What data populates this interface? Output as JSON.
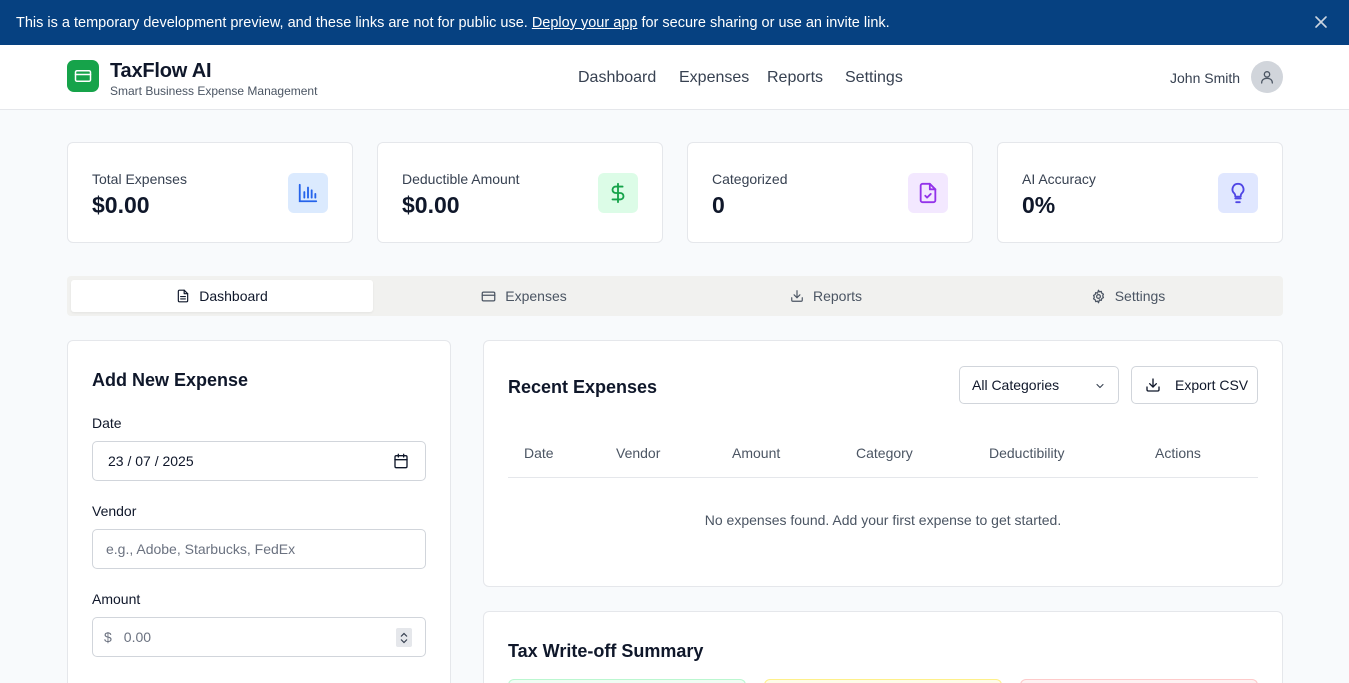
{
  "banner": {
    "text_before": "This is a temporary development preview, and these links are not for public use.",
    "link": "Deploy your app",
    "text_after": "for secure sharing or use an invite link.",
    "close_icon": "close-icon"
  },
  "header": {
    "title": "TaxFlow AI",
    "subtitle": "Smart Business Expense Management",
    "nav": [
      "Dashboard",
      "Expenses",
      "Reports",
      "Settings"
    ],
    "user_name": "John Smith",
    "logo_icon": "credit-card-icon",
    "avatar_icon": "user-icon"
  },
  "stats": [
    {
      "label": "Total Expenses",
      "value": "$0.00",
      "icon": "bar-chart-icon",
      "color": "#2563eb"
    },
    {
      "label": "Deductible Amount",
      "value": "$0.00",
      "icon": "dollar-icon",
      "color": "#16a34a"
    },
    {
      "label": "Categorized",
      "value": "0",
      "icon": "file-check-icon",
      "color": "#9333ea"
    },
    {
      "label": "AI Accuracy",
      "value": "0%",
      "icon": "lightbulb-icon",
      "color": "#4f46e5"
    }
  ],
  "tabs": [
    {
      "label": "Dashboard",
      "icon": "file-text-icon",
      "active": true
    },
    {
      "label": "Expenses",
      "icon": "credit-card-icon",
      "active": false
    },
    {
      "label": "Reports",
      "icon": "download-icon",
      "active": false
    },
    {
      "label": "Settings",
      "icon": "gear-icon",
      "active": false
    }
  ],
  "add_expense": {
    "title": "Add New Expense",
    "date_label": "Date",
    "date_value": "23 / 07 / 2025",
    "vendor_label": "Vendor",
    "vendor_placeholder": "e.g., Adobe, Starbucks, FedEx",
    "amount_label": "Amount",
    "amount_prefix": "$",
    "amount_placeholder": "0.00"
  },
  "recent_expenses": {
    "title": "Recent Expenses",
    "filter_value": "All Categories",
    "export_label": "Export CSV",
    "columns": [
      "Date",
      "Vendor",
      "Amount",
      "Category",
      "Deductibility",
      "Actions"
    ],
    "empty_message": "No expenses found. Add your first expense to get started."
  },
  "tax_summary": {
    "title": "Tax Write-off Summary"
  },
  "colors": {
    "banner": "#064181",
    "accent": "#16a34a"
  }
}
